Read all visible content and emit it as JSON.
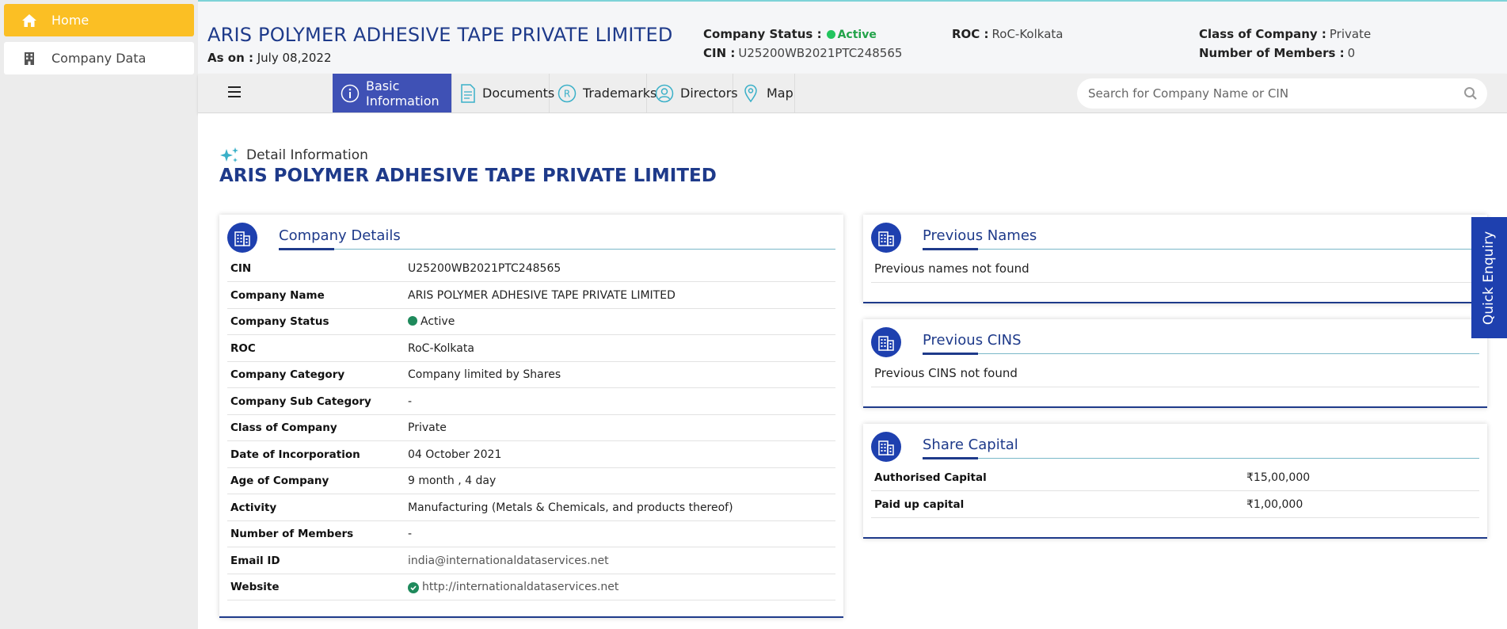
{
  "sidebar": {
    "home": "Home",
    "company_data": "Company Data"
  },
  "header": {
    "company_name": "ARIS POLYMER ADHESIVE TAPE PRIVATE LIMITED",
    "as_on_label": "As on :",
    "as_on_value": "July 08,2022",
    "status_label": "Company Status :",
    "status_value": "Active",
    "cin_label": "CIN :",
    "cin_value": "U25200WB2021PTC248565",
    "roc_label": "ROC :",
    "roc_value": "RoC-Kolkata",
    "class_label": "Class of Company :",
    "class_value": "Private",
    "members_label": "Number of Members :",
    "members_value": "0"
  },
  "tabs": [
    {
      "label": "Basic Information",
      "icon": "info-icon",
      "active": true
    },
    {
      "label": "Documents",
      "icon": "document-icon",
      "active": false
    },
    {
      "label": "Trademarks",
      "icon": "registered-icon",
      "active": false
    },
    {
      "label": "Directors",
      "icon": "user-icon",
      "active": false
    },
    {
      "label": "Map",
      "icon": "map-pin-icon",
      "active": false
    }
  ],
  "search": {
    "placeholder": "Search for Company Name or CIN"
  },
  "detail": {
    "heading": "Detail Information",
    "title": "ARIS POLYMER ADHESIVE TAPE PRIVATE LIMITED"
  },
  "company_details": {
    "title": "Company Details",
    "rows": [
      {
        "key": "CIN",
        "value": "U25200WB2021PTC248565"
      },
      {
        "key": "Company Name",
        "value": "ARIS POLYMER ADHESIVE TAPE PRIVATE LIMITED"
      },
      {
        "key": "Company Status",
        "value": "Active"
      },
      {
        "key": "ROC",
        "value": "RoC-Kolkata"
      },
      {
        "key": "Company Category",
        "value": "Company limited by Shares"
      },
      {
        "key": "Company Sub Category",
        "value": "-"
      },
      {
        "key": "Class of Company",
        "value": "Private"
      },
      {
        "key": "Date of Incorporation",
        "value": "04 October 2021"
      },
      {
        "key": "Age of Company",
        "value": "9 month , 4 day"
      },
      {
        "key": "Activity",
        "value": "Manufacturing (Metals & Chemicals, and products thereof)"
      },
      {
        "key": "Number of Members",
        "value": "-"
      },
      {
        "key": "Email ID",
        "value": "india@internationaldataservices.net"
      },
      {
        "key": "Website",
        "value": "http://internationaldataservices.net"
      }
    ]
  },
  "previous_names": {
    "title": "Previous Names",
    "note": "Previous names not found"
  },
  "previous_cins": {
    "title": "Previous CINS",
    "note": "Previous CINS not found"
  },
  "share_capital": {
    "title": "Share Capital",
    "rows": [
      {
        "key": "Authorised Capital",
        "value": "₹15,00,000"
      },
      {
        "key": "Paid up capital",
        "value": "₹1,00,000"
      }
    ]
  },
  "quick_enquiry": "Quick Enquiry",
  "colors": {
    "primary": "#1e3a8a",
    "tab_active": "#3f51b5",
    "home_button": "#fbbf24",
    "status_green": "#22c55e"
  }
}
